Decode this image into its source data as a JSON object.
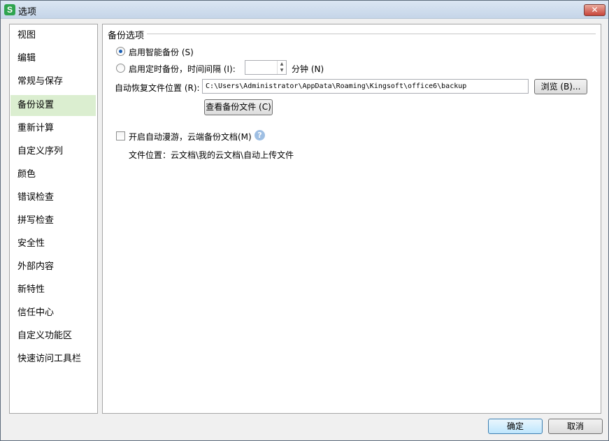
{
  "window": {
    "title": "选项",
    "app_icon_letter": "S",
    "close_symbol": "✕"
  },
  "sidebar": {
    "items": [
      {
        "label": "视图"
      },
      {
        "label": "编辑"
      },
      {
        "label": "常规与保存"
      },
      {
        "label": "备份设置",
        "active": true
      },
      {
        "label": "重新计算"
      },
      {
        "label": "自定义序列"
      },
      {
        "label": "颜色"
      },
      {
        "label": "错误检查"
      },
      {
        "label": "拼写检查"
      },
      {
        "label": "安全性"
      },
      {
        "label": "外部内容"
      },
      {
        "label": "新特性"
      },
      {
        "label": "信任中心"
      },
      {
        "label": "自定义功能区"
      },
      {
        "label": "快速访问工具栏"
      }
    ]
  },
  "backup": {
    "section_title": "备份选项",
    "smart_backup_label": "启用智能备份 (S)",
    "smart_backup_checked": true,
    "timed_backup_label": "启用定时备份，时间间隔 (I):",
    "timed_backup_checked": false,
    "interval_value": "",
    "minutes_label": "分钟 (N)",
    "recovery_label": "自动恢复文件位置 (R):",
    "recovery_path": "C:\\Users\\Administrator\\AppData\\Roaming\\Kingsoft\\office6\\backup",
    "browse_label": "浏览 (B)...",
    "view_backup_label": "查看备份文件 (C)",
    "roaming_label": "开启自动漫游，云端备份文档(M)",
    "roaming_checked": false,
    "help_symbol": "?",
    "file_location_text": "文件位置：云文档\\我的云文档\\自动上传文件"
  },
  "footer": {
    "ok_label": "确定",
    "cancel_label": "取消"
  },
  "colors": {
    "active_item_bg": "#dbeed0",
    "titlebar": "#c5d5e8",
    "close_button": "#c7443a"
  }
}
